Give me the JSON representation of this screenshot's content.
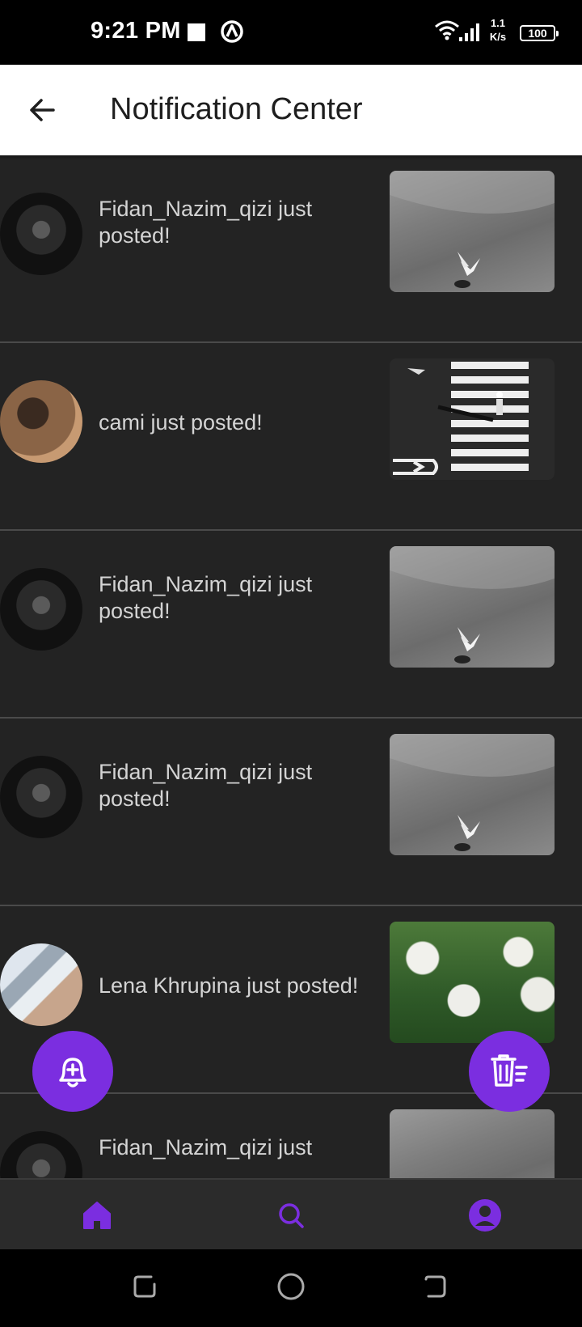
{
  "status_bar": {
    "time": "9:21 PM",
    "speed_top": "1.1",
    "speed_bottom": "K/s",
    "battery": "100"
  },
  "header": {
    "title": "Notification Center",
    "back_icon": "arrow-left-icon"
  },
  "notifications": [
    {
      "user": "Fidan_Nazim_qizi",
      "text": "Fidan_Nazim_qizi just posted!",
      "avatar": "dark-portrait",
      "thumbnail": "seagull-water"
    },
    {
      "user": "cami",
      "text": "cami just posted!",
      "avatar": "brown-portrait",
      "thumbnail": "crosswalk"
    },
    {
      "user": "Fidan_Nazim_qizi",
      "text": "Fidan_Nazim_qizi just posted!",
      "avatar": "dark-portrait",
      "thumbnail": "seagull-water"
    },
    {
      "user": "Fidan_Nazim_qizi",
      "text": "Fidan_Nazim_qizi just posted!",
      "avatar": "dark-portrait",
      "thumbnail": "seagull-water"
    },
    {
      "user": "Lena Khrupina",
      "text": "Lena Khrupina just posted!",
      "avatar": "city-portrait",
      "thumbnail": "white-flowers"
    },
    {
      "user": "Fidan_Nazim_qizi",
      "text": "Fidan_Nazim_qizi just",
      "avatar": "dark-portrait",
      "thumbnail": "seagull-water"
    }
  ],
  "fabs": {
    "left_icon": "bell-plus-icon",
    "right_icon": "trash-list-icon"
  },
  "bottom_nav": {
    "items": [
      "home-icon",
      "search-icon",
      "profile-icon"
    ]
  },
  "colors": {
    "accent": "#7b2ee0",
    "list_bg": "#232323",
    "text": "#d4d4d4",
    "divider": "#4a4a4a"
  }
}
